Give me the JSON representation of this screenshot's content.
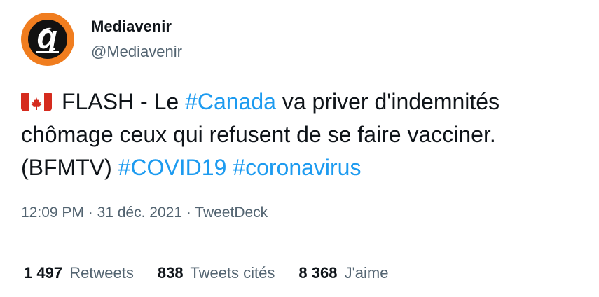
{
  "author": {
    "display_name": "Mediavenir",
    "handle": "@Mediavenir"
  },
  "tweet": {
    "flag_icon": "canada-flag-icon",
    "text_before_hashtag": "FLASH - Le ",
    "hashtag_canada": "#Canada",
    "text_middle": " va priver d'indemnités chômage ceux qui refusent de se faire vacciner. (BFMTV) ",
    "hashtag_covid": "#COVID19",
    "space": " ",
    "hashtag_corona": "#coronavirus"
  },
  "meta": {
    "time": "12:09 PM",
    "sep1": " · ",
    "date": "31 déc. 2021",
    "sep2": " · ",
    "source": "TweetDeck"
  },
  "stats": {
    "retweets_count": "1 497",
    "retweets_label": "Retweets",
    "quotes_count": "838",
    "quotes_label": "Tweets cités",
    "likes_count": "8 368",
    "likes_label": "J'aime"
  },
  "colors": {
    "link": "#1d9bf0",
    "secondary": "#536471",
    "avatar_ring": "#f07d1f"
  }
}
